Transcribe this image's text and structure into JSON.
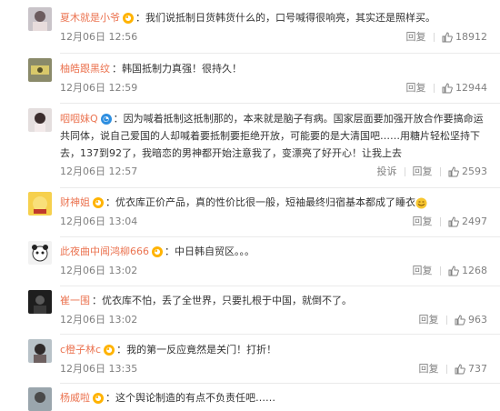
{
  "comments": [
    {
      "user": "夏木就是小爷",
      "text": "：我们说抵制日货韩货什么的，口号喊得很响亮，其实还是照样买。",
      "date": "12月06日 12:56",
      "reply": "回复",
      "likes": "18912"
    },
    {
      "user": "柚皓跟黑纹",
      "text": "：韩国抵制力真强！很持久！",
      "date": "12月06日 12:59",
      "reply": "回复",
      "likes": "12944"
    },
    {
      "user": "咽咽妹Q",
      "text": "：因为喊着抵制这抵制那的，本来就是脑子有病。国家层面要加强开放合作要搞命运共同体，说自己爱国的人却喊着要抵制要拒绝开放，可能要的是大清国吧……用糖片轻松坚持下去，137到92了，我暗恋的男神都开始注意我了，变漂亮了好开心！让我上去",
      "date": "12月06日 12:57",
      "report": "投诉",
      "reply": "回复",
      "likes": "2593"
    },
    {
      "user": "财神姐",
      "text": "：优衣库正价产品，真的性价比很一般，短袖最终归宿基本都成了睡衣",
      "date": "12月06日 13:04",
      "reply": "回复",
      "likes": "2497"
    },
    {
      "user": "此夜曲中闻鸿柳666",
      "text": "：中日韩自贸区。。。",
      "date": "12月06日 13:02",
      "reply": "回复",
      "likes": "1268"
    },
    {
      "user": "崔一围",
      "text": "：优衣库不怕，丢了全世界，只要扎根于中国，就倒不了。",
      "date": "12月06日 13:02",
      "reply": "回复",
      "likes": "963"
    },
    {
      "user": "c橙子林c",
      "text": "：我的第一反应竟然是关门！打折！",
      "date": "12月06日 13:35",
      "reply": "回复",
      "likes": "737"
    },
    {
      "user": "杨威啦",
      "text": "：这个舆论制造的有点不负责任吧……",
      "date": "",
      "reply": "",
      "likes": ""
    }
  ],
  "colors": {
    "username": "#eb7350",
    "meta": "#808080",
    "badge": "#ffb300"
  }
}
